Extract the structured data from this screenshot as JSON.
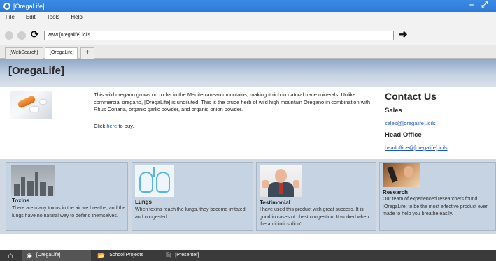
{
  "window": {
    "title": "[OregaLife]",
    "controls": "– ⤢"
  },
  "menu": [
    "File",
    "Edit",
    "Tools",
    "Help"
  ],
  "nav": {
    "url": "www.[oregalife].icils"
  },
  "tabs": [
    {
      "label": "[WebSearch]"
    },
    {
      "label": "[OregaLife]"
    },
    {
      "label": "+"
    }
  ],
  "page": {
    "site_title": "[OregaLife]",
    "intro": "This wild oregano grows on rocks in the Mediterranean mountains, making it rich in natural trace minerals. Unlike commercial oregano, [OregaLife] is undiluted. This is the crude herb of wild high mountain Oregano in combination with Rhus Coriaria, organic garlic powder, and organic onion powder.",
    "buy_prefix": "Click ",
    "buy_link": "here",
    "buy_suffix": " to buy.",
    "contact": {
      "heading": "Contact Us",
      "sales_heading": "Sales",
      "sales_email": "sales@[oregalife].icils",
      "office_heading": "Head Office",
      "office_email": "headoffice@[oregalife].icils"
    },
    "cards": [
      {
        "title": "Toxins",
        "text": "There are many toxins in the air we breathe, and the lungs have no natural way to defend themselves."
      },
      {
        "title": "Lungs",
        "text": "When toxins reach the lungs, they become irritated and congested."
      },
      {
        "title": "Testimonial",
        "text": "I have used this product with great success. It is good in cases of chest congestion. It worked when the antibiotics didn't."
      },
      {
        "title": "Research",
        "text": "Our team of experienced researchers found [OregaLife] to be the most effective product ever made to help you breathe easily."
      }
    ]
  },
  "taskbar": {
    "items": [
      {
        "label": "[OregaLife]",
        "icon": "globe-icon"
      },
      {
        "label": "School Projects",
        "icon": "folder-icon"
      },
      {
        "label": "[Presenter]",
        "icon": "document-icon"
      }
    ]
  }
}
